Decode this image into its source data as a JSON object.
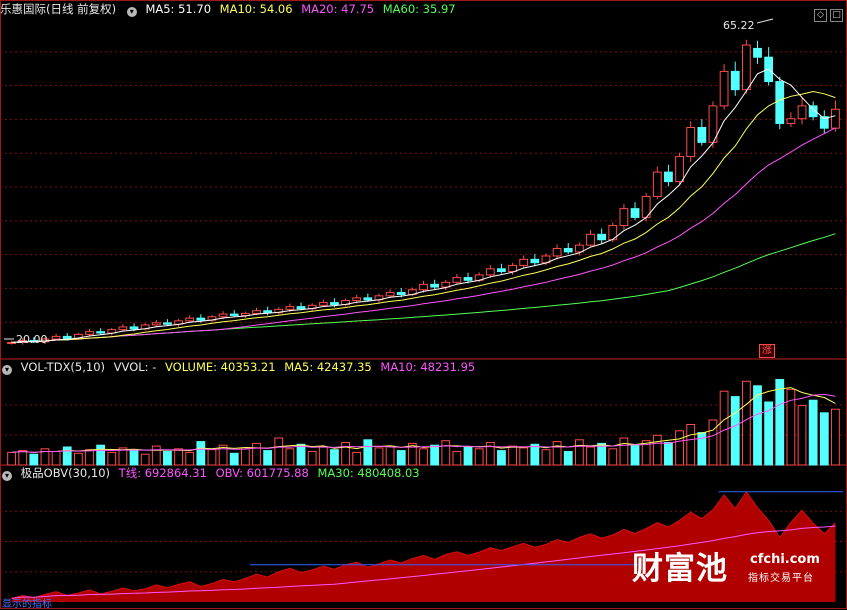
{
  "main_pane": {
    "stock_name": "乐惠国际",
    "period": "(日线 前复权)",
    "ma5": "MA5: 51.70",
    "ma10": "MA10: 54.06",
    "ma20": "MA20: 47.75",
    "ma60": "MA60: 35.97",
    "high_label": "65.22",
    "low_label": "20.00",
    "limit_up_badge": "涨"
  },
  "vol_pane": {
    "name": "VOL-TDX(5,10)",
    "vvol": "VVOL: -",
    "volume": "VOLUME: 40353.21",
    "ma5": "MA5: 42437.35",
    "ma10": "MA10: 48231.95"
  },
  "obv_pane": {
    "name": "极品OBV(30,10)",
    "t_line": "T线: 692864.31",
    "obv": "OBV: 601775.88",
    "ma30": "MA30: 480408.03"
  },
  "bottom_tab": "显示的指标",
  "window_controls": [
    "◇",
    "□"
  ],
  "watermark": {
    "title": "财富池",
    "domain": "cfchi.com",
    "slogan": "指标交易平台"
  },
  "colors": {
    "up": "#ff4a4a",
    "down": "#54ffff",
    "ma5": "#ffffff",
    "ma10": "#ffff55",
    "ma20": "#ff55ff",
    "ma60": "#55ff55",
    "grid": "#7a1010",
    "obv_fill": "#b00000",
    "t_line": "#ff55ff",
    "obv_line": "#ff55ff",
    "ma30_line": "#3060ff"
  },
  "chart_data": {
    "type": "candlestick",
    "price_range": [
      18,
      68
    ],
    "price_close": [
      20.0,
      20.3,
      20.1,
      20.5,
      20.9,
      20.6,
      21.2,
      21.6,
      21.4,
      21.9,
      22.3,
      22.0,
      22.6,
      22.9,
      22.7,
      23.2,
      23.6,
      23.3,
      23.8,
      24.2,
      24.0,
      24.3,
      24.7,
      24.4,
      24.9,
      25.3,
      25.0,
      25.5,
      25.9,
      25.6,
      26.2,
      26.6,
      26.3,
      26.9,
      27.4,
      27.1,
      27.8,
      28.6,
      28.2,
      28.9,
      29.6,
      29.2,
      30.0,
      30.9,
      30.5,
      31.4,
      32.3,
      31.8,
      32.8,
      33.9,
      33.4,
      34.4,
      36.0,
      35.2,
      37.3,
      39.8,
      38.5,
      41.6,
      45.2,
      43.8,
      47.5,
      51.8,
      49.6,
      55.0,
      60.1,
      57.4,
      64.0,
      62.2,
      58.6,
      52.4,
      53.1,
      55.0,
      53.4,
      51.7,
      54.5
    ],
    "price_open": [
      19.9,
      20.0,
      20.3,
      20.1,
      20.5,
      20.9,
      20.6,
      21.2,
      21.6,
      21.4,
      21.9,
      22.3,
      22.0,
      22.6,
      22.9,
      22.7,
      23.2,
      23.6,
      23.3,
      23.8,
      24.2,
      24.0,
      24.3,
      24.7,
      24.4,
      24.9,
      25.3,
      25.0,
      25.5,
      25.9,
      25.6,
      26.2,
      26.6,
      26.3,
      26.9,
      27.4,
      27.1,
      27.8,
      28.6,
      28.2,
      28.9,
      29.6,
      29.2,
      30.0,
      30.9,
      30.5,
      31.4,
      32.3,
      31.8,
      32.8,
      33.9,
      33.4,
      34.4,
      36.0,
      35.2,
      37.3,
      39.8,
      38.5,
      41.6,
      45.2,
      43.8,
      47.5,
      51.8,
      49.6,
      55.0,
      60.1,
      57.4,
      63.5,
      62.2,
      58.6,
      52.4,
      53.1,
      55.0,
      53.4,
      51.7
    ],
    "volume": [
      14,
      16,
      12,
      18,
      15,
      20,
      13,
      17,
      22,
      14,
      19,
      16,
      12,
      21,
      15,
      18,
      14,
      26,
      17,
      22,
      13,
      19,
      24,
      16,
      30,
      18,
      23,
      15,
      20,
      17,
      25,
      14,
      28,
      19,
      21,
      16,
      24,
      18,
      22,
      27,
      15,
      20,
      18,
      25,
      16,
      21,
      19,
      23,
      17,
      26,
      15,
      28,
      20,
      24,
      18,
      30,
      22,
      27,
      33,
      25,
      38,
      45,
      36,
      50,
      82,
      76,
      93,
      88,
      70,
      95,
      84,
      66,
      72,
      58,
      62
    ]
  }
}
